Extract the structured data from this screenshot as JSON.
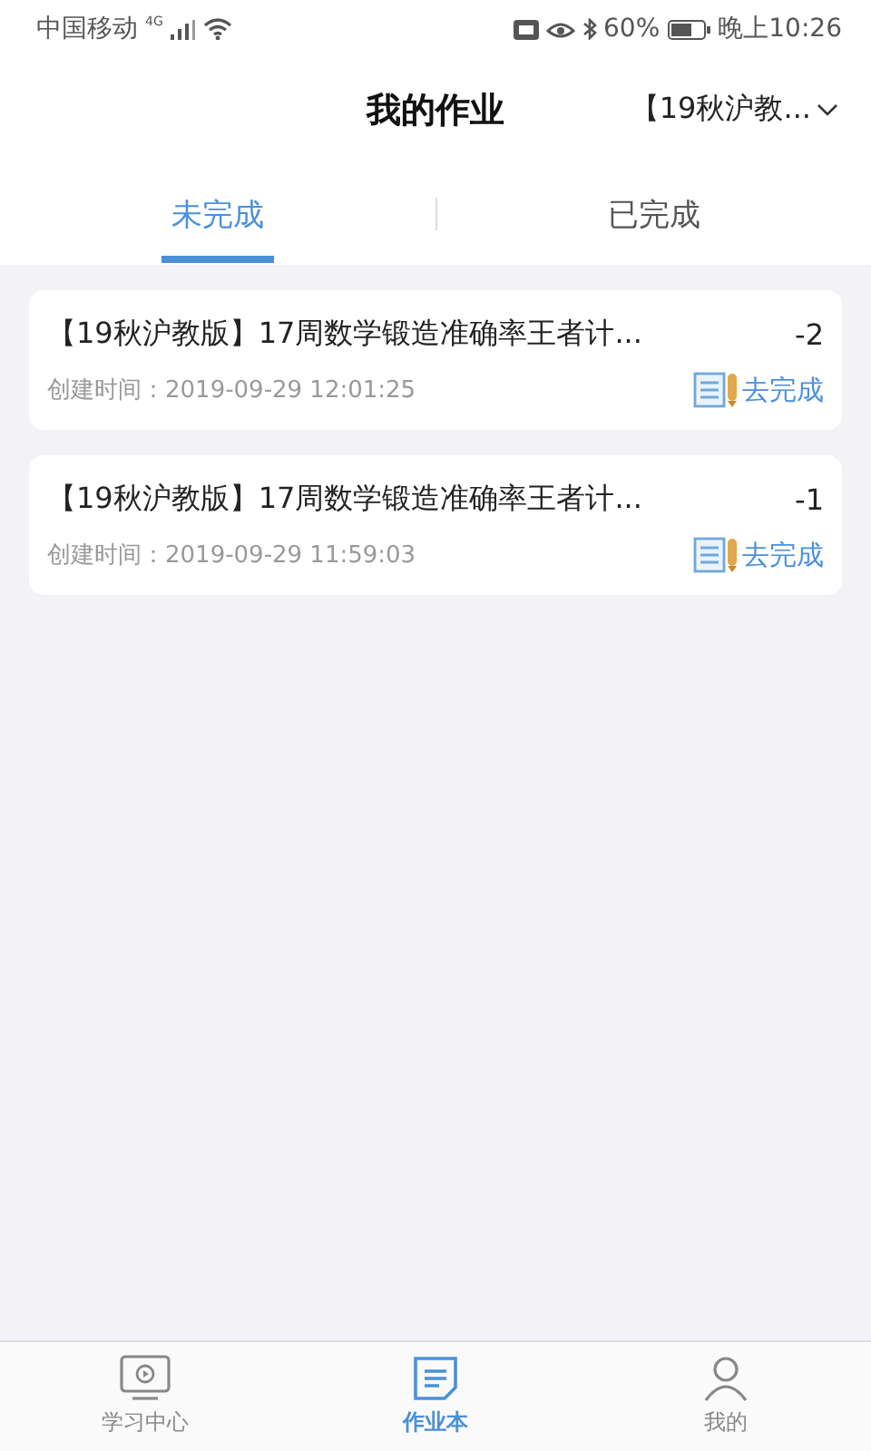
{
  "status_bar": {
    "carrier": "中国移动",
    "network": "4G",
    "battery": "60%",
    "time": "晚上10:26"
  },
  "header": {
    "title": "我的作业",
    "selector": "【19秋沪教..."
  },
  "tabs": [
    {
      "label": "未完成",
      "selected": true
    },
    {
      "label": "已完成",
      "selected": false
    }
  ],
  "assignments": [
    {
      "title": "【19秋沪教版】17周数学锻造准确率王者计...",
      "count": "-2",
      "created": "创建时间：2019-09-29 12:01:25",
      "action": "去完成"
    },
    {
      "title": "【19秋沪教版】17周数学锻造准确率王者计...",
      "count": "-1",
      "created": "创建时间：2019-09-29 11:59:03",
      "action": "去完成"
    }
  ],
  "bottom_nav": [
    {
      "kind": "study",
      "label": "学习中心",
      "selected": false
    },
    {
      "kind": "homework",
      "label": "作业本",
      "selected": true
    },
    {
      "kind": "me",
      "label": "我的",
      "selected": false
    }
  ]
}
